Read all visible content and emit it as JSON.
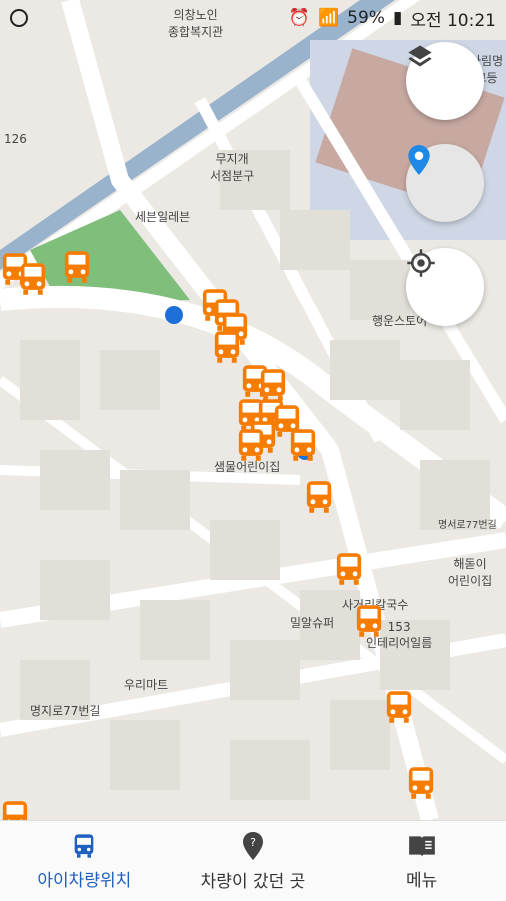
{
  "status_bar": {
    "battery": "59%",
    "time": "오전 10:21"
  },
  "map_labels": {
    "hall": "의창노인\n종합복지관",
    "bookstore": "무지개\n서점분구",
    "seven_eleven": "세븐일레븐",
    "store_right": "행운스토어",
    "kindergarten1": "샘물어린이집",
    "kindergarten2": "해돋이\n어린이집",
    "noodle": "사거리칼국수",
    "interior": "153\n인테리어일름",
    "mart1": "밀알슈퍼",
    "mart2": "우리마트",
    "school": "사림명\n고등",
    "num_126": "126",
    "road_1": "명지로77번길",
    "road_2": "명서로77번길"
  },
  "fabs": [
    {
      "name": "layers-button",
      "icon": "layers-icon"
    },
    {
      "name": "location-pin-button",
      "icon": "location-pin-icon"
    },
    {
      "name": "my-location-button",
      "icon": "crosshair-icon"
    }
  ],
  "bottom_nav": {
    "items": [
      {
        "label": "아이차량위치",
        "icon": "bus-icon",
        "active": true
      },
      {
        "label": "차량이 갔던 곳",
        "icon": "place-marker-icon",
        "active": false
      },
      {
        "label": "메뉴",
        "icon": "book-menu-icon",
        "active": false
      }
    ]
  },
  "colors": {
    "accent": "#1e5fbf",
    "bus": "#f57c00",
    "park": "#7fbf7b",
    "water": "#99b3cc"
  }
}
